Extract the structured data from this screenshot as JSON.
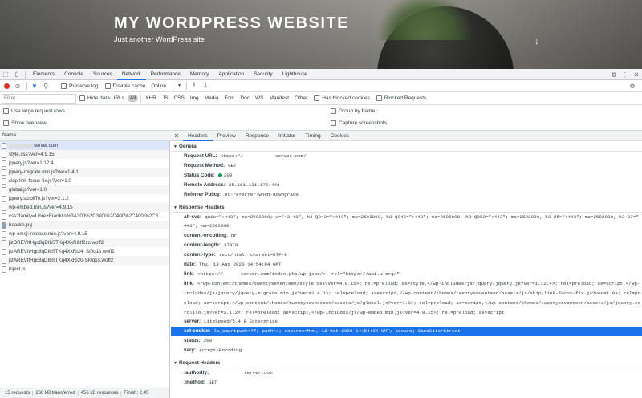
{
  "site": {
    "title": "MY WORDPRESS WEBSITE",
    "description": "Just another WordPress site"
  },
  "devtools": {
    "tabs": [
      "Elements",
      "Console",
      "Sources",
      "Network",
      "Performance",
      "Memory",
      "Application",
      "Security",
      "Lighthouse"
    ],
    "active_tab": "Network"
  },
  "network_toolbar": {
    "preserve_log": "Preserve log",
    "disable_cache": "Disable cache",
    "throttle": "Online"
  },
  "filter_bar": {
    "placeholder": "Filter",
    "hide_data_urls": "Hide data URLs",
    "types": [
      "All",
      "XHR",
      "JS",
      "CSS",
      "Img",
      "Media",
      "Font",
      "Doc",
      "WS",
      "Manifest",
      "Other"
    ],
    "has_blocked_cookies": "Has blocked cookies",
    "blocked_requests": "Blocked Requests"
  },
  "options": {
    "large_rows": "Use large request rows",
    "group_by_frame": "Group by frame",
    "show_overview": "Show overview",
    "capture_screenshots": "Capture screenshots"
  },
  "request_list": {
    "header": "Name",
    "items": [
      "server.com",
      "style.css?ver=4.9.15",
      "jquery.js?ver=1.12.4",
      "jquery-migrate.min.js?ver=1.4.1",
      "skip-link-focus-fix.js?ver=1.0",
      "global.js?ver=1.0",
      "jquery.scrollTo.js?ver=2.1.2",
      "wp-embed.min.js?ver=4.9.15",
      "css?family=Libre+Franklin%3A300%2C300i%2C400%2C400i%2C6...",
      "header.jpg",
      "wp-emoji-release.min.js?ver=4.9.15",
      "jizDREVItHgc8qDIbSTKq4XkRiUf2zc.woff2",
      "jizAREVItHgc8qDIbSTKq4XkRi24_SI0q1s.woff2",
      "jizAREVItHgc8qDIbSTKq4XkRi20-SI0q1s.woff2",
      "inject.js"
    ]
  },
  "status_bar": {
    "requests": "15 requests",
    "transferred": "260 kB transferred",
    "resources": "456 kB resources",
    "finish": "Finish: 2.45"
  },
  "detail_tabs": [
    "Headers",
    "Preview",
    "Response",
    "Initiator",
    "Timing",
    "Cookies"
  ],
  "general": {
    "title": "General",
    "request_url_key": "Request URL:",
    "request_url_val_a": "https://",
    "request_url_val_b": "server.com/",
    "method_key": "Request Method:",
    "method_val": "GET",
    "status_key": "Status Code:",
    "status_val": "200",
    "remote_key": "Remote Address:",
    "remote_val": "35.161.131.175:443",
    "referrer_key": "Referrer Policy:",
    "referrer_val": "no-referrer-when-downgrade"
  },
  "response_headers": {
    "title": "Response Headers",
    "alt_svc_key": "alt-svc:",
    "alt_svc_val": "quic=\":443\"; ma=2592000; v=\"43,46\", h3-Q043=\":443\"; ma=2592000, h3-Q046=\":443\"; ma=2592000, h3-Q050=\":443\"; ma=2592000, h3-25=\":443\"; ma=2592000, h3-27=\":443\"; ma=2592000",
    "content_encoding_key": "content-encoding:",
    "content_encoding_val": "br",
    "content_length_key": "content-length:",
    "content_length_val": "17879",
    "content_type_key": "content-type:",
    "content_type_val": "text/html; charset=UTF-8",
    "date_key": "date:",
    "date_val": "Thu, 13 Aug 2020 14:54:04 GMT",
    "link1_key": "link:",
    "link1_val_a": "<https://",
    "link1_val_b": "server.com/index.php/wp-json/>; rel=\"https://api.w.org/\"",
    "link2_key": "link:",
    "link2_val": "</wp-content/themes/twentyseventeen/style.css?ver=4.9.15>; rel=preload; as=style,</wp-includes/js/jquery/jquery.js?ver=1.12.4>; rel=preload; as=script,</wp-includes/js/jquery/jquery-migrate.min.js?ver=1.4.1>; rel=preload; as=script,</wp-content/themes/twentyseventeen/assets/js/skip-link-focus-fix.js?ver=1.0>; rel=preload; as=script,</wp-content/themes/twentyseventeen/assets/js/global.js?ver=1.0>; rel=preload; as=script,</wp-content/themes/twentyseventeen/assets/js/jquery.scrollTo.js?ver=2.1.2>; rel=preload; as=script,</wp-includes/js/wp-embed.min.js?ver=4.9.15>; rel=preload; as=script",
    "server_key": "server:",
    "server_val": "LiteSpeed/5.4.8 Enterprise",
    "setcookie_key": "set-cookie:",
    "setcookie_val": "ls_smartpush=7f; path=/; expires=Mon, 12 Oct 2020 14:54:04 GMT; secure; SameSite=Strict",
    "status_key": "status:",
    "status_val": "200",
    "vary_key": "vary:",
    "vary_val": "Accept-Encoding"
  },
  "request_headers": {
    "title": "Request Headers",
    "authority_key": ":authority:",
    "authority_val": "server.com",
    "method_key": ":method:",
    "method_val": "GET"
  },
  "colors": {
    "accent": "#1a73e8",
    "record": "#d93025",
    "status_ok": "#0f9d58"
  }
}
